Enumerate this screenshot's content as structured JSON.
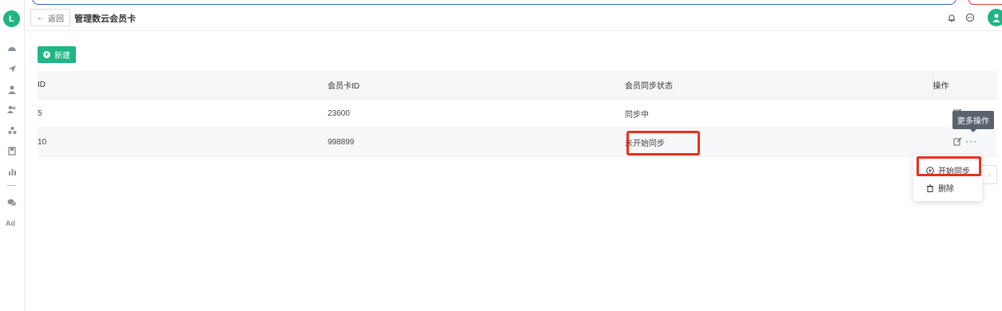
{
  "app": {
    "logo_text": "L"
  },
  "header": {
    "back_label": "返回",
    "title": "管理数云会员卡"
  },
  "toolbar": {
    "new_label": "新建"
  },
  "table": {
    "columns": [
      "ID",
      "会员卡ID",
      "会员同步状态",
      "操作"
    ],
    "rows": [
      {
        "id": "5",
        "card_id": "23600",
        "status": "同步中"
      },
      {
        "id": "10",
        "card_id": "998899",
        "status": "未开始同步"
      }
    ]
  },
  "tooltip": {
    "more_actions": "更多操作"
  },
  "menu": {
    "start_sync": "开始同步",
    "delete": "删除"
  },
  "sidebar": {
    "ad_label": "Ad",
    "icons": [
      "dashboard-icon",
      "send-icon",
      "user-icon",
      "users-icon",
      "apps-icon",
      "bookmark-icon",
      "chart-icon",
      "wechat-icon"
    ]
  },
  "colors": {
    "brand": "#1fb584",
    "highlight": "#e8301c"
  }
}
